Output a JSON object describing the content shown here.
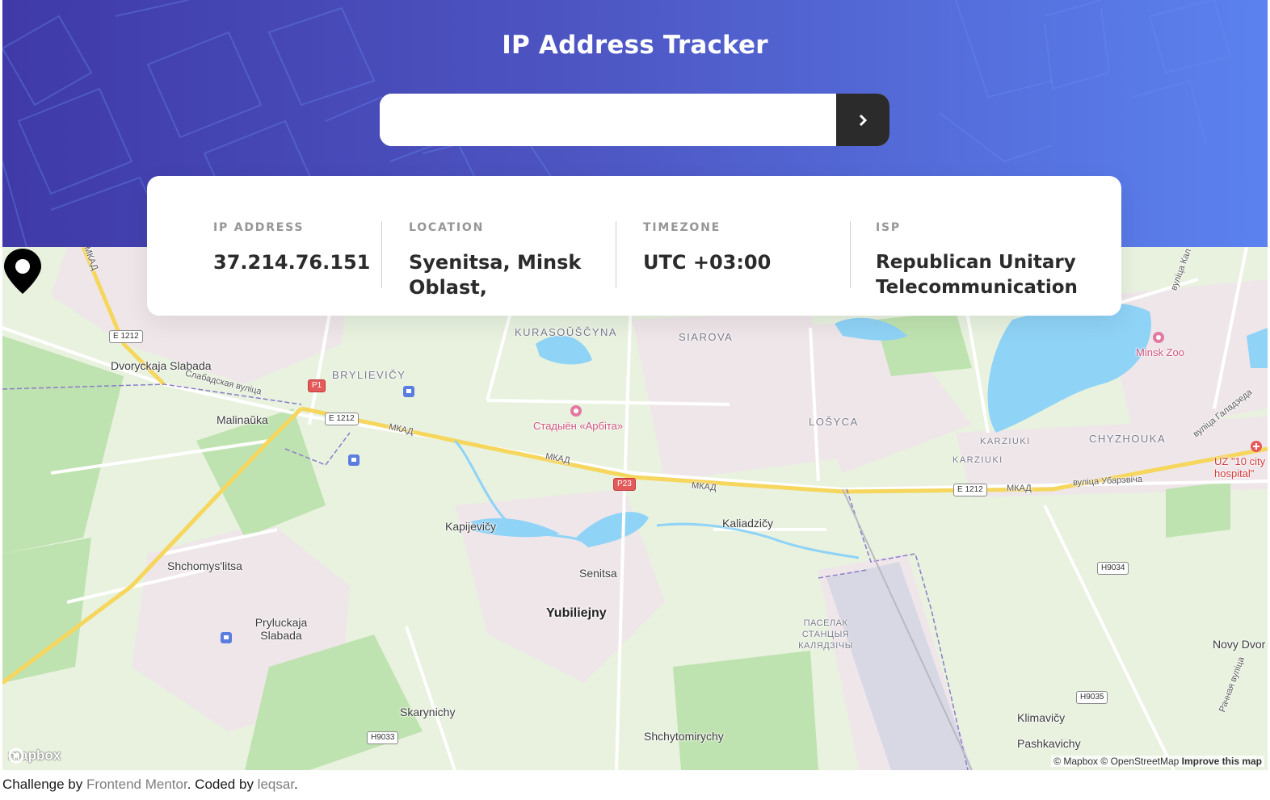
{
  "header": {
    "title": "IP Address Tracker",
    "search_placeholder": "",
    "search_value": "",
    "submit_icon": "chevron-right-icon"
  },
  "info": {
    "ip_label": "IP ADDRESS",
    "ip_value": "37.214.76.151",
    "location_label": "LOCATION",
    "location_value": "Syenitsa, Minsk Oblast,",
    "timezone_label": "TIMEZONE",
    "timezone_value": "UTC +03:00",
    "isp_label": "ISP",
    "isp_value": "Republican Unitary Telecommunication"
  },
  "map": {
    "places": {
      "dvoryckaja": "Dvoryckaja Slabada",
      "malinauka": "Malinaŭka",
      "bryllievicy": "BRYLIEVIČY",
      "kurasouscyna": "KURASOŬŠČYNA",
      "siarova": "SIAROVA",
      "stadium": "Стадыён «Арбіта»",
      "losyca": "LOŠYCA",
      "karziuki1": "KARZIUKI",
      "karziuki2": "KARZIUKI",
      "chyzhouka": "CHYZHOUKA",
      "minsk_zoo": "Minsk Zoo",
      "uz_hospital": "UZ \"10 city hospital\"",
      "kapijevicy": "Kapijevičy",
      "kaliadzicy": "Kaliadzičy",
      "shchomys": "Shchomys'litsa",
      "senitsa": "Senitsa",
      "yubiliejny": "Yubiliejny",
      "pryluckaja": "Pryluckaja Slabada",
      "pasielak": "ПАСЕЛАК СТАНЦЫЯ КАЛЯДЗІЧЫ",
      "novy_dvor": "Novy Dvor",
      "skarynichy": "Skarynichy",
      "klimavicy": "Klimavičy",
      "pashkavichy": "Pashkavichy",
      "shchytomirychy": "Shchytomirychy"
    },
    "roads": {
      "slabadskaja": "Слабадская вуліца",
      "mkad1": "МКАД",
      "mkad2": "МКАД",
      "mkad3": "МКАД",
      "mkad4": "МКАД",
      "mkad_vertical": "МКАД",
      "ubarevicha": "вуліца Убарэвіча",
      "haladzieda": "вуліца Галадзеда",
      "rachnaja": "Рачная вуліца",
      "kal": "вуліца Кал"
    },
    "shields": {
      "e1212_a": "E 1212",
      "e1212_b": "E 1212",
      "e1212_c": "E 1212",
      "p1": "P1",
      "p23": "P23",
      "h9034": "H9034",
      "h9035": "H9035",
      "h9033": "H9033"
    },
    "logo": "mapbox",
    "attribution_mapbox": "© Mapbox",
    "attribution_osm": "© OpenStreetMap",
    "attribution_improve": "Improve this map",
    "marker_icon": "location-pin-icon"
  },
  "footer": {
    "prefix": "Challenge by ",
    "frontend_mentor": "Frontend Mentor",
    "middle": ". Coded by ",
    "author": "leqsar",
    "suffix": "."
  },
  "colors": {
    "header_start": "#3f3aa8",
    "header_end": "#5b82ef",
    "button": "#2b2b2b",
    "label_gray": "#969696",
    "value_dark": "#2b2b2b"
  }
}
